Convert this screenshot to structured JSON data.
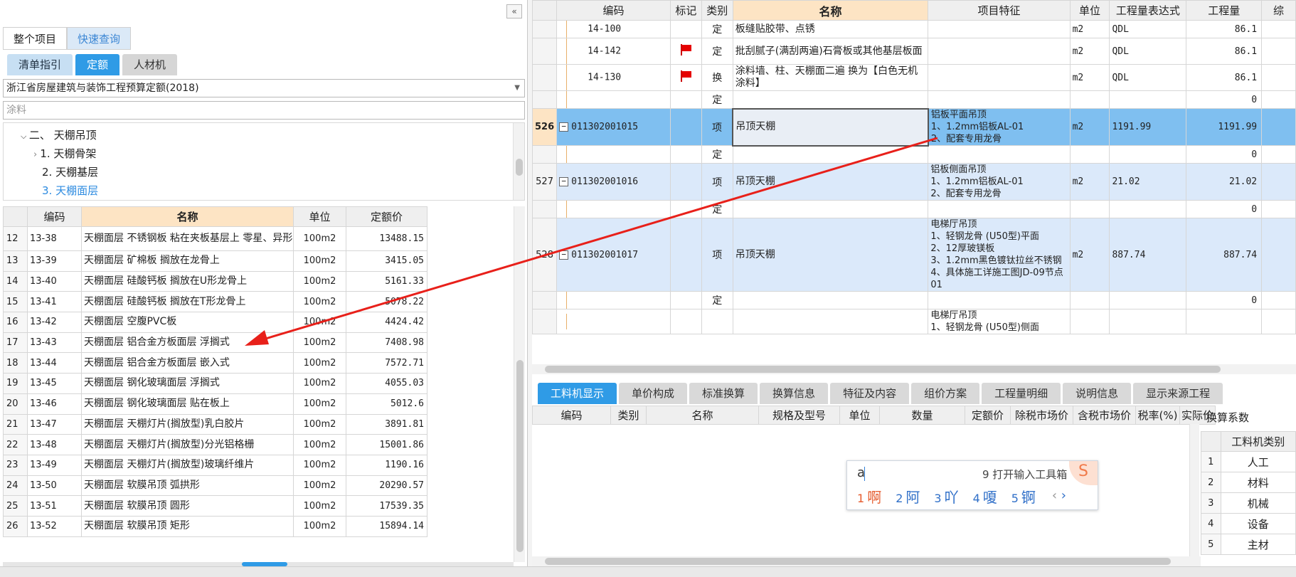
{
  "left": {
    "collapse_glyph": "«",
    "top_tabs": [
      "整个项目",
      "快速查询"
    ],
    "sub_tabs": [
      "清单指引",
      "定额",
      "人材机"
    ],
    "quota_library": "浙江省房屋建筑与装饰工程预算定额(2018)",
    "search_value": "涂料",
    "tree": [
      {
        "label": "二、 天棚吊顶",
        "expanded": true
      },
      {
        "label": "1. 天棚骨架",
        "expanded": false
      },
      {
        "label": "2. 天棚基层"
      },
      {
        "label": "3. 天棚面层",
        "selected": true
      }
    ],
    "table": {
      "headers": [
        "编码",
        "名称",
        "单位",
        "定额价"
      ],
      "rows": [
        {
          "idx": "12",
          "code": "13-38",
          "name": "天棚面层 不锈钢板 粘在夹板基层上 零星、异形",
          "unit": "100m2",
          "price": "13488.15"
        },
        {
          "idx": "13",
          "code": "13-39",
          "name": "天棚面层 矿棉板 搁放在龙骨上",
          "unit": "100m2",
          "price": "3415.05"
        },
        {
          "idx": "14",
          "code": "13-40",
          "name": "天棚面层 硅酸钙板 搁放在U形龙骨上",
          "unit": "100m2",
          "price": "5161.33"
        },
        {
          "idx": "15",
          "code": "13-41",
          "name": "天棚面层 硅酸钙板 搁放在T形龙骨上",
          "unit": "100m2",
          "price": "5078.22"
        },
        {
          "idx": "16",
          "code": "13-42",
          "name": "天棚面层 空腹PVC板",
          "unit": "100m2",
          "price": "4424.42"
        },
        {
          "idx": "17",
          "code": "13-43",
          "name": "天棚面层 铝合金方板面层 浮搁式",
          "unit": "100m2",
          "price": "7408.98"
        },
        {
          "idx": "18",
          "code": "13-44",
          "name": "天棚面层 铝合金方板面层 嵌入式",
          "unit": "100m2",
          "price": "7572.71"
        },
        {
          "idx": "19",
          "code": "13-45",
          "name": "天棚面层 钢化玻璃面层 浮搁式",
          "unit": "100m2",
          "price": "4055.03"
        },
        {
          "idx": "20",
          "code": "13-46",
          "name": "天棚面层 钢化玻璃面层 贴在板上",
          "unit": "100m2",
          "price": "5012.6"
        },
        {
          "idx": "21",
          "code": "13-47",
          "name": "天棚面层 天棚灯片(搁放型)乳白胶片",
          "unit": "100m2",
          "price": "3891.81"
        },
        {
          "idx": "22",
          "code": "13-48",
          "name": "天棚面层 天棚灯片(搁放型)分光铝格栅",
          "unit": "100m2",
          "price": "15001.86"
        },
        {
          "idx": "23",
          "code": "13-49",
          "name": "天棚面层 天棚灯片(搁放型)玻璃纤维片",
          "unit": "100m2",
          "price": "1190.16"
        },
        {
          "idx": "24",
          "code": "13-50",
          "name": "天棚面层 软膜吊顶 弧拱形",
          "unit": "100m2",
          "price": "20290.57"
        },
        {
          "idx": "25",
          "code": "13-51",
          "name": "天棚面层 软膜吊顶 圆形",
          "unit": "100m2",
          "price": "17539.35"
        },
        {
          "idx": "26",
          "code": "13-52",
          "name": "天棚面层 软膜吊顶 矩形",
          "unit": "100m2",
          "price": "15894.14"
        }
      ]
    }
  },
  "main": {
    "headers": [
      "编码",
      "标记",
      "类别",
      "名称",
      "项目特征",
      "单位",
      "工程量表达式",
      "工程量",
      "综"
    ],
    "rows": [
      {
        "num": "",
        "code": "14-100",
        "flag": false,
        "type": "定",
        "name": "板缝贴胶带、点锈",
        "feature": "",
        "unit": "m2",
        "expr": "QDL",
        "qty": "86.1"
      },
      {
        "num": "",
        "code": "14-142",
        "flag": true,
        "type": "定",
        "name": "批刮腻子(满刮两遍)石膏板或其他基层板面",
        "feature": "",
        "unit": "m2",
        "expr": "QDL",
        "qty": "86.1"
      },
      {
        "num": "",
        "code": "14-130",
        "flag": true,
        "type": "换",
        "name": "涂料墙、柱、天棚面二遍  换为【白色无机涂料】",
        "feature": "",
        "unit": "m2",
        "expr": "QDL",
        "qty": "86.1"
      },
      {
        "num": "",
        "code": "",
        "flag": false,
        "type": "定",
        "name": "",
        "feature": "",
        "unit": "",
        "expr": "",
        "qty": "0"
      },
      {
        "num": "526",
        "code": "011302001015",
        "flag": false,
        "type": "项",
        "name": "吊顶天棚",
        "feature": "铝板平面吊顶\n1、1.2mm铝板AL-01\n2、配套专用龙骨",
        "unit": "m2",
        "expr": "1191.99",
        "qty": "1191.99"
      },
      {
        "num": "",
        "code": "",
        "flag": false,
        "type": "定",
        "name": "",
        "feature": "",
        "unit": "",
        "expr": "",
        "qty": "0"
      },
      {
        "num": "527",
        "code": "011302001016",
        "flag": false,
        "type": "项",
        "name": "吊顶天棚",
        "feature": "铝板侧面吊顶\n1、1.2mm铝板AL-01\n2、配套专用龙骨",
        "unit": "m2",
        "expr": "21.02",
        "qty": "21.02"
      },
      {
        "num": "",
        "code": "",
        "flag": false,
        "type": "定",
        "name": "",
        "feature": "",
        "unit": "",
        "expr": "",
        "qty": "0"
      },
      {
        "num": "528",
        "code": "011302001017",
        "flag": false,
        "type": "项",
        "name": "吊顶天棚",
        "feature": "电梯厅吊顶\n1、轻钢龙骨 (U50型)平面\n2、12厚玻镁板\n3、1.2mm黑色镀钛拉丝不锈钢\n4、具体施工详施工图JD-09节点01",
        "unit": "m2",
        "expr": "887.74",
        "qty": "887.74"
      },
      {
        "num": "",
        "code": "",
        "flag": false,
        "type": "定",
        "name": "",
        "feature": "",
        "unit": "",
        "expr": "",
        "qty": "0"
      },
      {
        "num": "",
        "code": "",
        "flag": false,
        "type": "",
        "name": "",
        "feature": "电梯厅吊顶\n1、轻钢龙骨 (U50型)侧面",
        "unit": "",
        "expr": "",
        "qty": ""
      }
    ]
  },
  "bottom": {
    "tabs": [
      "工料机显示",
      "单价构成",
      "标准换算",
      "换算信息",
      "特征及内容",
      "组价方案",
      "工程量明细",
      "说明信息",
      "显示来源工程"
    ],
    "res_headers": [
      "编码",
      "类别",
      "名称",
      "规格及型号",
      "单位",
      "数量",
      "定额价",
      "除税市场价",
      "含税市场价",
      "税率(%)",
      "实际价"
    ],
    "conv_title": "换算系数",
    "conv_header": "工料机类别",
    "conv_rows": [
      {
        "i": "1",
        "t": "人工"
      },
      {
        "i": "2",
        "t": "材料"
      },
      {
        "i": "3",
        "t": "机械"
      },
      {
        "i": "4",
        "t": "设备"
      },
      {
        "i": "5",
        "t": "主材"
      }
    ]
  },
  "ime": {
    "typed": "a",
    "toolbox": "9 打开输入工具箱",
    "candidates": [
      {
        "n": "1",
        "c": "啊"
      },
      {
        "n": "2",
        "c": "阿"
      },
      {
        "n": "3",
        "c": "吖"
      },
      {
        "n": "4",
        "c": "嗄"
      },
      {
        "n": "5",
        "c": "锕"
      }
    ],
    "nav_prev": "‹",
    "nav_next": "›"
  },
  "colors": {
    "accent_blue": "#2f9be6",
    "header_highlight": "#fde4c4",
    "selected_row": "#7fbff0",
    "item_row": "#dbe9fa",
    "flag_red": "#e60000",
    "arrow_red": "#e8201a"
  },
  "icons": [
    "collapse-icon",
    "chevron-down-icon",
    "chevron-right-icon",
    "flag-icon",
    "minus-icon",
    "arrow-annotation"
  ]
}
